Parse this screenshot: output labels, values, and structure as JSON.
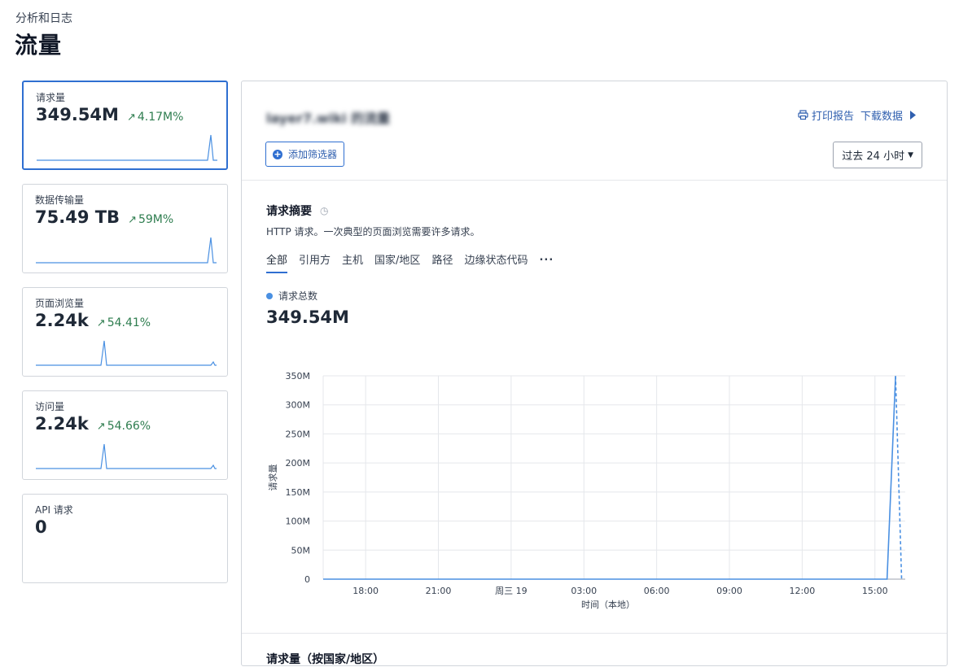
{
  "header": {
    "breadcrumb": "分析和日志",
    "title": "流量"
  },
  "metrics": [
    {
      "label": "请求量",
      "value": "349.54M",
      "change": "4.17M%",
      "active": true
    },
    {
      "label": "数据传输量",
      "value": "75.49 TB",
      "change": "59M%"
    },
    {
      "label": "页面浏览量",
      "value": "2.24k",
      "change": "54.41%"
    },
    {
      "label": "访问量",
      "value": "2.24k",
      "change": "54.66%"
    },
    {
      "label": "API 请求",
      "value": "0",
      "change": ""
    }
  ],
  "panel": {
    "zone_title": "layer7.wiki 的流量",
    "print_label": "打印报告",
    "download_label": "下载数据",
    "add_filter_label": "添加筛选器",
    "time_range": "过去 24 小时"
  },
  "summary": {
    "title": "请求摘要",
    "description": "HTTP 请求。一次典型的页面浏览需要许多请求。",
    "tabs": [
      "全部",
      "引用方",
      "主机",
      "国家/地区",
      "路径",
      "边缘状态代码",
      "..."
    ],
    "legend_label": "请求总数",
    "total": "349.54M",
    "next_section_title": "请求量（按国家/地区）"
  },
  "colors": {
    "accent": "#2f6fd1",
    "positive": "#2e7d4f",
    "series": "#4a90e2"
  },
  "chart_data": {
    "type": "line",
    "title": "",
    "xlabel": "时间（本地）",
    "ylabel": "请求量",
    "x_ticks": [
      "18:00",
      "21:00",
      "周三 19",
      "03:00",
      "06:00",
      "09:00",
      "12:00",
      "15:00"
    ],
    "y_ticks": [
      "0",
      "50M",
      "100M",
      "150M",
      "200M",
      "250M",
      "300M",
      "350M"
    ],
    "ylim": [
      0,
      350000000
    ],
    "x_range_hours": [
      -1.75,
      22.25
    ],
    "series": [
      {
        "name": "请求总数",
        "x_hours": [
          -1.75,
          21.5,
          21.85
        ],
        "values": [
          0,
          0,
          349540000
        ],
        "style": "solid"
      },
      {
        "name": "请求总数",
        "x_hours": [
          21.85,
          22.1
        ],
        "values": [
          349540000,
          0
        ],
        "style": "dashed"
      }
    ],
    "grid": true
  }
}
